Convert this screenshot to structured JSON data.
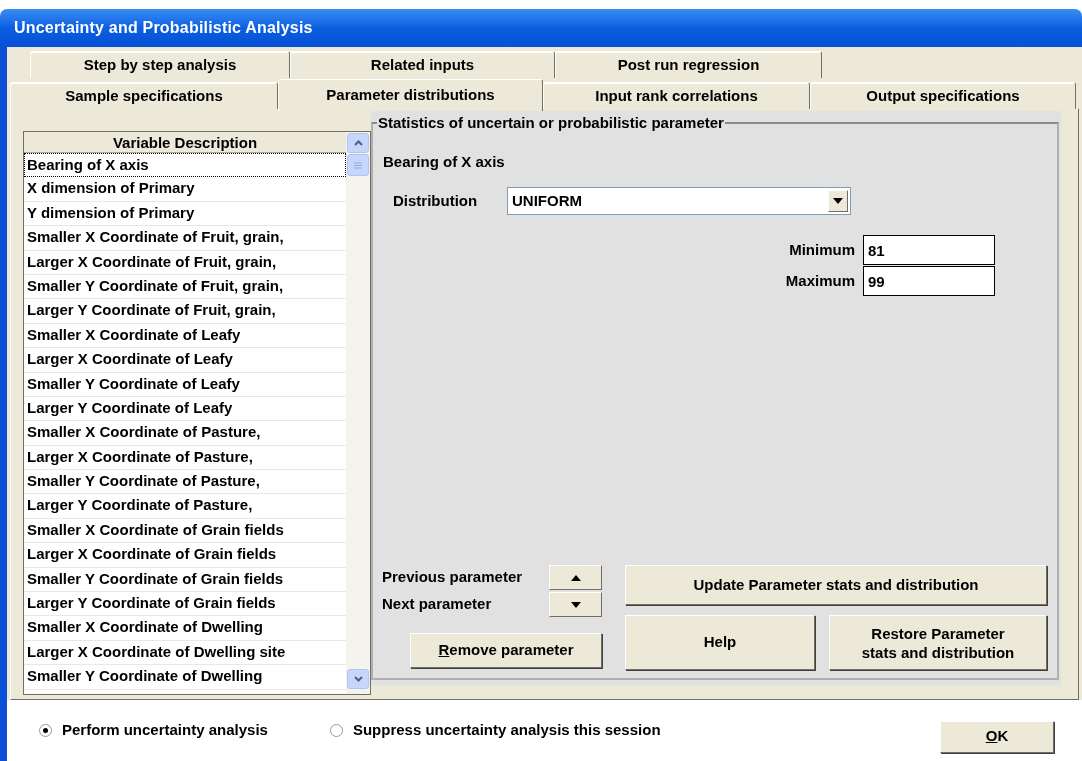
{
  "window": {
    "title": "Uncertainty and Probabilistic Analysis"
  },
  "tab_rows": [
    [
      {
        "label": "Step by step analysis",
        "selected": false
      },
      {
        "label": "Related inputs",
        "selected": false
      },
      {
        "label": "Post run regression",
        "selected": false
      }
    ],
    [
      {
        "label": "Sample specifications",
        "selected": false
      },
      {
        "label": "Parameter distributions",
        "selected": true
      },
      {
        "label": "Input rank correlations",
        "selected": false
      },
      {
        "label": "Output specifications",
        "selected": false
      }
    ]
  ],
  "list": {
    "header": "Variable Description",
    "items": [
      {
        "label": "Bearing of X axis",
        "selected": true
      },
      {
        "label": "X dimension of Primary",
        "selected": false
      },
      {
        "label": "Y dimension of Primary",
        "selected": false
      },
      {
        "label": "Smaller X Coordinate of Fruit, grain,",
        "selected": false
      },
      {
        "label": "Larger X Coordinate of Fruit, grain,",
        "selected": false
      },
      {
        "label": "Smaller Y Coordinate of Fruit, grain,",
        "selected": false
      },
      {
        "label": "Larger Y Coordinate of Fruit, grain,",
        "selected": false
      },
      {
        "label": "Smaller X Coordinate of Leafy",
        "selected": false
      },
      {
        "label": "Larger X Coordinate of Leafy",
        "selected": false
      },
      {
        "label": "Smaller Y Coordinate of Leafy",
        "selected": false
      },
      {
        "label": "Larger Y Coordinate of Leafy",
        "selected": false
      },
      {
        "label": "Smaller X Coordinate of Pasture,",
        "selected": false
      },
      {
        "label": "Larger X Coordinate of Pasture,",
        "selected": false
      },
      {
        "label": "Smaller Y Coordinate of Pasture,",
        "selected": false
      },
      {
        "label": "Larger Y Coordinate of Pasture,",
        "selected": false
      },
      {
        "label": "Smaller X Coordinate of Grain fields",
        "selected": false
      },
      {
        "label": "Larger X Coordinate of Grain fields",
        "selected": false
      },
      {
        "label": "Smaller Y Coordinate of Grain fields",
        "selected": false
      },
      {
        "label": "Larger Y Coordinate of Grain fields",
        "selected": false
      },
      {
        "label": "Smaller X Coordinate of Dwelling",
        "selected": false
      },
      {
        "label": "Larger X Coordinate of Dwelling site",
        "selected": false
      },
      {
        "label": "Smaller Y Coordinate of Dwelling",
        "selected": false
      }
    ]
  },
  "group": {
    "title": "Statistics of uncertain or probabilistic parameter",
    "parameter_name": "Bearing of X axis",
    "distribution_label": "Distribution",
    "distribution": "UNIFORM",
    "fields": [
      {
        "label": "Minimum",
        "value": "81"
      },
      {
        "label": "Maximum",
        "value": "99"
      }
    ],
    "nav": [
      {
        "label": "Previous parameter",
        "kind": "up"
      },
      {
        "label": "Next parameter",
        "kind": "down"
      }
    ],
    "remove_button": {
      "label": "Remove parameter"
    },
    "update_button": {
      "label": "Update Parameter stats and distribution"
    },
    "help_button": {
      "label": "Help"
    },
    "restore_button": {
      "label": "Restore Parameter\nstats and distribution"
    }
  },
  "modes": [
    {
      "label": "Perform uncertainty analysis",
      "selected": true
    },
    {
      "label": "Suppress uncertainty analysis this session",
      "selected": false
    }
  ],
  "ok_button": {
    "label": "OK"
  }
}
